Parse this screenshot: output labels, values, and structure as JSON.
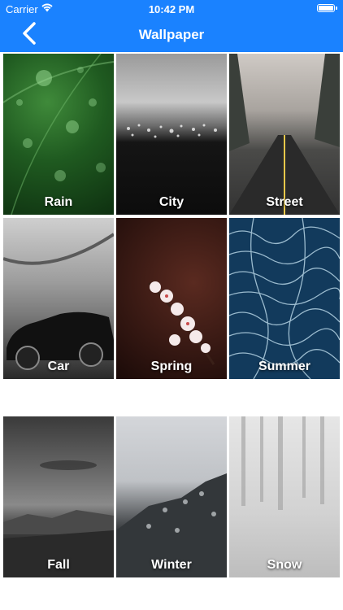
{
  "status_bar": {
    "carrier": "Carrier",
    "time": "10:42 PM"
  },
  "nav_bar": {
    "title": "Wallpaper",
    "back_icon": "chevron-left-icon"
  },
  "colors": {
    "nav_background": "#1a82ff",
    "nav_text": "#ffffff"
  },
  "wallpapers": [
    {
      "label": "Rain"
    },
    {
      "label": "City"
    },
    {
      "label": "Street"
    },
    {
      "label": "Car"
    },
    {
      "label": "Spring"
    },
    {
      "label": "Summer"
    },
    {
      "label": "Fall"
    },
    {
      "label": "Winter"
    },
    {
      "label": "Snow"
    }
  ]
}
